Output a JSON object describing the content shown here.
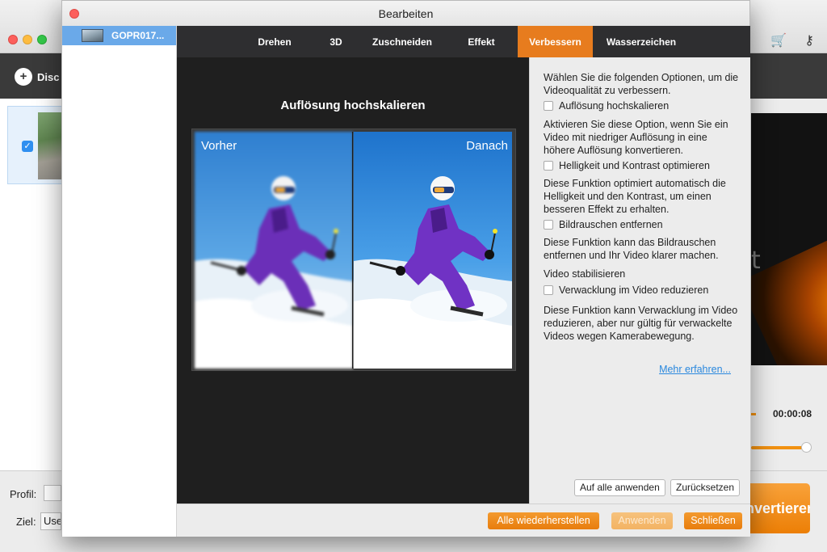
{
  "main_window": {
    "toolbar": {
      "disc_label": "Disc l"
    },
    "preview": {
      "overlay_text": "t",
      "time": "00:00:08"
    },
    "bottom": {
      "profil_label": "Profil:",
      "ziel_label": "Ziel:",
      "ziel_value": "Use",
      "convert_label": "Konvertieren"
    },
    "colors": {
      "accent": "#f29111"
    }
  },
  "dialog": {
    "title": "Bearbeiten",
    "file_item": {
      "name": "GOPR017..."
    },
    "tabs": [
      {
        "label": "Drehen",
        "active": false
      },
      {
        "label": "3D",
        "active": false
      },
      {
        "label": "Zuschneiden",
        "active": false
      },
      {
        "label": "Effekt",
        "active": false
      },
      {
        "label": "Verbessern",
        "active": true
      },
      {
        "label": "Wasserzeichen",
        "active": false
      }
    ],
    "preview": {
      "heading": "Auflösung hochskalieren",
      "before_label": "Vorher",
      "after_label": "Danach"
    },
    "options": {
      "intro": "Wählen Sie die folgenden Optionen, um die Videoqualität zu verbessern.",
      "upscale": {
        "label": "Auflösung hochskalieren",
        "checked": false,
        "description": "Aktivieren Sie diese Option, wenn Sie ein Video mit niedriger Auflösung in eine höhere Auflösung konvertieren."
      },
      "brightness": {
        "label": "Helligkeit und Kontrast optimieren",
        "checked": false,
        "description": "Diese Funktion optimiert automatisch die Helligkeit und den Kontrast, um einen besseren Effekt zu erhalten."
      },
      "denoise": {
        "label": "Bildrauschen entfernen",
        "checked": false,
        "description": "Diese Funktion kann das Bildrauschen entfernen und Ihr Video klarer machen."
      },
      "stabilize_heading": "Video stabilisieren",
      "stabilize": {
        "label": "Verwacklung im Video reduzieren",
        "checked": false,
        "description": "Diese Funktion kann Verwacklung im Video reduzieren, aber nur gültig für verwackelte Videos wegen Kamerabewegung."
      },
      "more_link": "Mehr erfahren...",
      "apply_all_button": "Auf alle anwenden",
      "reset_button": "Zurücksetzen"
    },
    "footer": {
      "restore_all_button": "Alle wiederherstellen",
      "apply_button": "Anwenden",
      "apply_enabled": false,
      "close_button": "Schließen"
    },
    "colors": {
      "active_tab": "#e77c1e",
      "link": "#2a88de",
      "tabbar": "#2e2e30",
      "preview_bg": "#1f1f1f"
    }
  }
}
